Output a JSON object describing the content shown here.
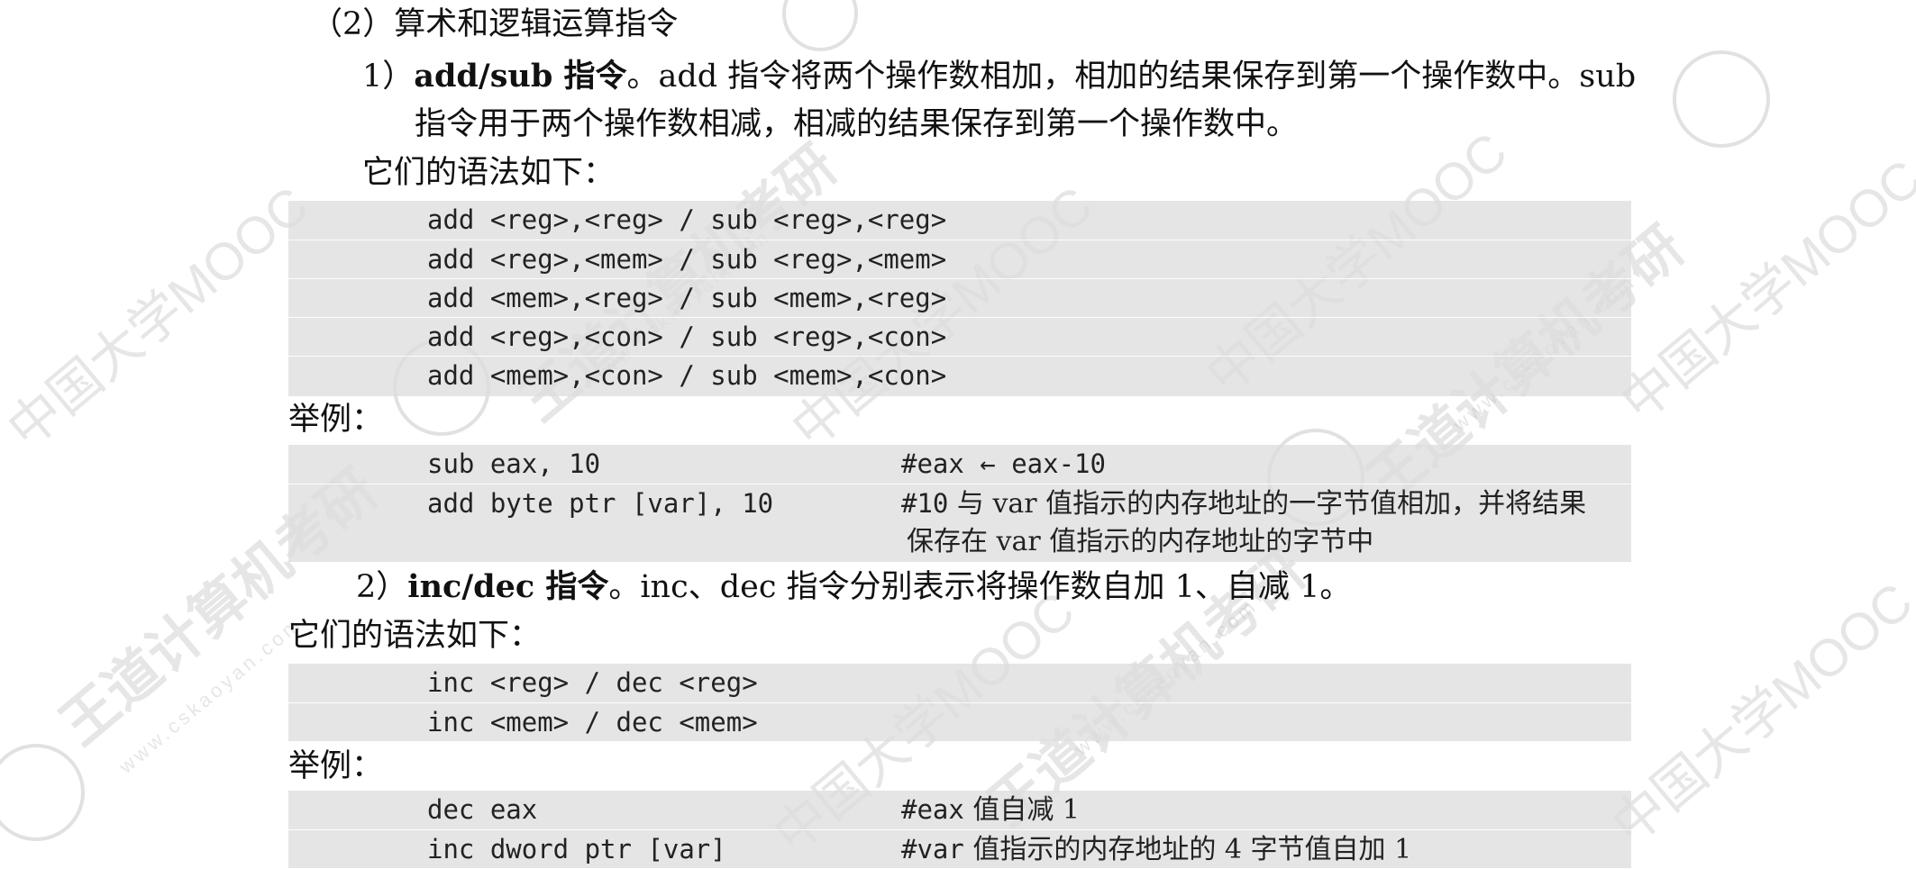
{
  "section_heading": "（2）算术和逻辑运算指令",
  "add_sub": {
    "item_prefix": "1）",
    "item_title": "add/sub 指令",
    "desc_line1": "。add 指令将两个操作数相加，相加的结果保存到第一个操作数中。sub",
    "desc_line2": "指令用于两个操作数相减，相减的结果保存到第一个操作数中。",
    "syntax_intro": "它们的语法如下：",
    "syntax": [
      "add <reg>,<reg> / sub <reg>,<reg>",
      "add <reg>,<mem> / sub <reg>,<mem>",
      "add <mem>,<reg> / sub <mem>,<reg>",
      "add <reg>,<con> / sub <reg>,<con>",
      "add <mem>,<con> / sub <mem>,<con>"
    ],
    "example_intro": "举例：",
    "examples": [
      {
        "code": "sub eax, 10",
        "comment_code": "#eax",
        "comment_text": " ← eax-10"
      },
      {
        "code": "add byte ptr [var], 10",
        "comment_code": "#10",
        "comment_text": " 与 var 值指示的内存地址的一字节值相加，并将结果",
        "comment_cont": "保存在 var 值指示的内存地址的字节中"
      }
    ]
  },
  "inc_dec": {
    "item_prefix": "2）",
    "item_title": "inc/dec 指令",
    "desc_line1": "。inc、dec 指令分别表示将操作数自加 1、自减 1。",
    "syntax_intro": "它们的语法如下：",
    "syntax": [
      "inc <reg> / dec <reg>",
      "inc <mem> / dec <mem>"
    ],
    "example_intro": "举例：",
    "examples": [
      {
        "code": "dec eax",
        "comment_code": "#eax",
        "comment_text": " 值自减 1"
      },
      {
        "code": "inc dword ptr [var]",
        "comment_code": "#var",
        "comment_text": " 值指示的内存地址的 4 字节值自加 1"
      }
    ]
  },
  "watermarks": {
    "brand_text": "王道计算机考研",
    "url_text": "www.cskaoyan.com",
    "mooc_text": "中国大学MOOC",
    "logo_icon": "wangdao-logo-icon",
    "color": "#c8c8c8"
  }
}
